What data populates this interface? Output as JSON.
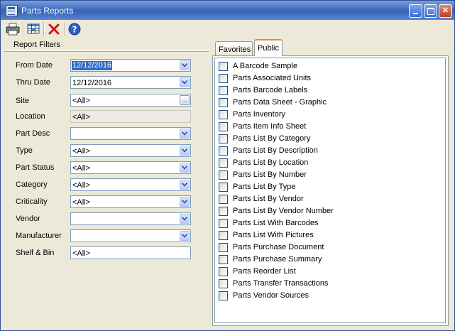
{
  "window": {
    "title": "Parts Reports",
    "icon": "report-window-icon",
    "controls": [
      "minimize-icon",
      "maximize-icon",
      "close-icon"
    ]
  },
  "toolbar": {
    "buttons": [
      {
        "name": "print",
        "icon": "printer-icon"
      },
      {
        "name": "grid",
        "icon": "grid-view-icon"
      },
      {
        "name": "delete",
        "icon": "red-x-icon"
      },
      {
        "name": "help",
        "icon": "help-icon"
      }
    ]
  },
  "filters": {
    "header": "Report Filters",
    "from_date": {
      "label": "From Date",
      "value": "12/12/2016"
    },
    "thru_date": {
      "label": "Thru Date",
      "value": "12/12/2016"
    },
    "site": {
      "label": "Site",
      "value": "<All>",
      "button": "..."
    },
    "location": {
      "label": "Location",
      "value": "<All>"
    },
    "part_desc": {
      "label": "Part Desc",
      "value": ""
    },
    "type": {
      "label": "Type",
      "value": "<All>"
    },
    "part_status": {
      "label": "Part Status",
      "value": "<All>"
    },
    "category": {
      "label": "Category",
      "value": "<All>"
    },
    "criticality": {
      "label": "Criticality",
      "value": "<All>"
    },
    "vendor": {
      "label": "Vendor",
      "value": ""
    },
    "manufacturer": {
      "label": "Manufacturer",
      "value": ""
    },
    "shelf_bin": {
      "label": "Shelf & Bin",
      "value": "<All>"
    }
  },
  "tabs": {
    "favorites": "Favorites",
    "public": "Public",
    "active": "Public"
  },
  "reports": [
    "A Barcode Sample",
    "Parts Associated Units",
    "Parts Barcode Labels",
    "Parts Data Sheet - Graphic",
    "Parts Inventory",
    "Parts Item Info Sheet",
    "Parts List By Category",
    "Parts List By Description",
    "Parts List By Location",
    "Parts List By Number",
    "Parts List By Type",
    "Parts List By Vendor",
    "Parts List By Vendor Number",
    "Parts List With Barcodes",
    "Parts List With Pictures",
    "Parts Purchase Document",
    "Parts Purchase Summary",
    "Parts Reorder List",
    "Parts Transfer Transactions",
    "Parts Vendor Sources"
  ],
  "colors": {
    "titlebar": "#3d6bc0",
    "selection": "#316ac5",
    "tab_accent": "#e68b2c"
  }
}
